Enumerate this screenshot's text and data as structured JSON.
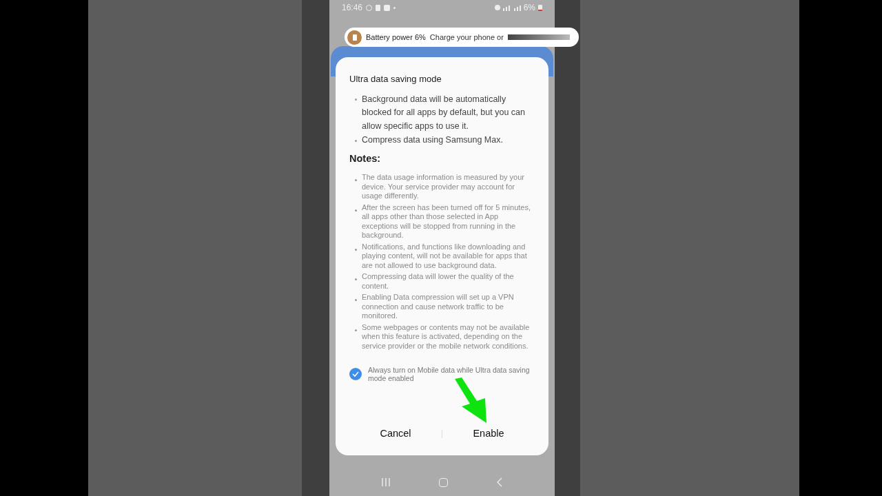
{
  "status_bar": {
    "time": "16:46",
    "battery": "6%"
  },
  "notification": {
    "title": "Battery power 6%",
    "text": "Charge your phone or"
  },
  "dialog": {
    "title": "Ultra data saving mode",
    "bullets": [
      "Background data will be automatically blocked for all apps by default, but you can allow specific apps to use it.",
      "Compress data using Samsung Max."
    ],
    "notes_heading": "Notes:",
    "notes": [
      "The data usage information is measured by your device. Your service provider may account for usage differently.",
      "After the screen has been turned off for 5 minutes, all apps other than those selected in App exceptions will be stopped from running in the background.",
      "Notifications, and functions like downloading and playing content, will not be available for apps that are not allowed to use background data.",
      "Compressing data will lower the quality of the content.",
      "Enabling Data compression will set up a VPN connection and cause network traffic to be monitored.",
      "Some webpages or contents may not be available when this feature is activated, depending on the service provider or the mobile network conditions."
    ],
    "checkbox": {
      "label": "Always turn on Mobile data while Ultra data saving mode enabled",
      "checked": true
    },
    "buttons": [
      "Cancel",
      "Enable"
    ]
  }
}
